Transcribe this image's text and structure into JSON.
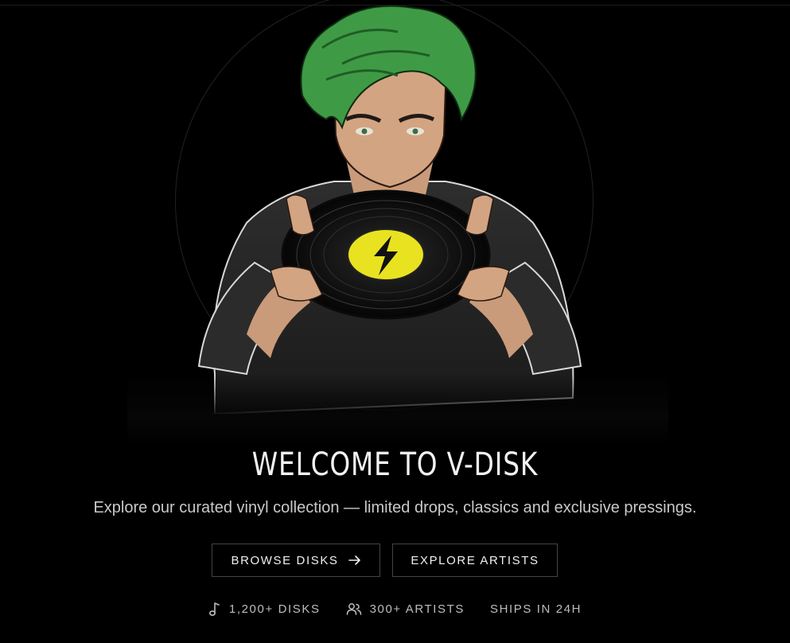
{
  "hero": {
    "title": "WELCOME TO V-DISK",
    "subtitle": "Explore our curated vinyl collection — limited drops, classics and exclusive pressings."
  },
  "actions": {
    "browse_label": "BROWSE DISKS",
    "explore_label": "EXPLORE ARTISTS"
  },
  "stats": [
    {
      "icon": "music-note-icon",
      "label": "1,200+ DISKS"
    },
    {
      "icon": "users-icon",
      "label": "300+ ARTISTS"
    },
    {
      "icon": "",
      "label": "SHIPS IN 24H"
    }
  ],
  "colors": {
    "background": "#000000",
    "hair": "#3f9a45",
    "label_yellow": "#e9e221",
    "text": "#f2f2f2",
    "muted": "#bdbdbd"
  }
}
